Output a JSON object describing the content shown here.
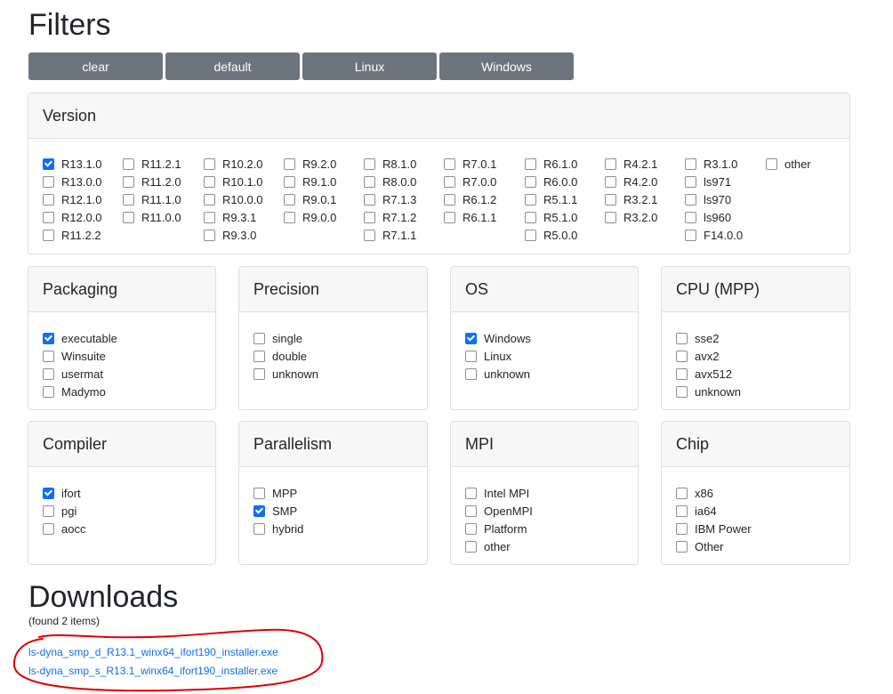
{
  "filters_title": "Filters",
  "buttons": [
    "clear",
    "default",
    "Linux",
    "Windows"
  ],
  "version": {
    "title": "Version",
    "columns": [
      [
        {
          "label": "R13.1.0",
          "checked": true
        },
        {
          "label": "R13.0.0",
          "checked": false
        },
        {
          "label": "R12.1.0",
          "checked": false
        },
        {
          "label": "R12.0.0",
          "checked": false
        },
        {
          "label": "R11.2.2",
          "checked": false
        }
      ],
      [
        {
          "label": "R11.2.1",
          "checked": false
        },
        {
          "label": "R11.2.0",
          "checked": false
        },
        {
          "label": "R11.1.0",
          "checked": false
        },
        {
          "label": "R11.0.0",
          "checked": false
        }
      ],
      [
        {
          "label": "R10.2.0",
          "checked": false
        },
        {
          "label": "R10.1.0",
          "checked": false
        },
        {
          "label": "R10.0.0",
          "checked": false
        },
        {
          "label": "R9.3.1",
          "checked": false
        },
        {
          "label": "R9.3.0",
          "checked": false
        }
      ],
      [
        {
          "label": "R9.2.0",
          "checked": false
        },
        {
          "label": "R9.1.0",
          "checked": false
        },
        {
          "label": "R9.0.1",
          "checked": false
        },
        {
          "label": "R9.0.0",
          "checked": false
        }
      ],
      [
        {
          "label": "R8.1.0",
          "checked": false
        },
        {
          "label": "R8.0.0",
          "checked": false
        },
        {
          "label": "R7.1.3",
          "checked": false
        },
        {
          "label": "R7.1.2",
          "checked": false
        },
        {
          "label": "R7.1.1",
          "checked": false
        }
      ],
      [
        {
          "label": "R7.0.1",
          "checked": false
        },
        {
          "label": "R7.0.0",
          "checked": false
        },
        {
          "label": "R6.1.2",
          "checked": false
        },
        {
          "label": "R6.1.1",
          "checked": false
        }
      ],
      [
        {
          "label": "R6.1.0",
          "checked": false
        },
        {
          "label": "R6.0.0",
          "checked": false
        },
        {
          "label": "R5.1.1",
          "checked": false
        },
        {
          "label": "R5.1.0",
          "checked": false
        },
        {
          "label": "R5.0.0",
          "checked": false
        }
      ],
      [
        {
          "label": "R4.2.1",
          "checked": false
        },
        {
          "label": "R4.2.0",
          "checked": false
        },
        {
          "label": "R3.2.1",
          "checked": false
        },
        {
          "label": "R3.2.0",
          "checked": false
        }
      ],
      [
        {
          "label": "R3.1.0",
          "checked": false
        },
        {
          "label": "ls971",
          "checked": false
        },
        {
          "label": "ls970",
          "checked": false
        },
        {
          "label": "ls960",
          "checked": false
        },
        {
          "label": "F14.0.0",
          "checked": false
        }
      ],
      [
        {
          "label": "other",
          "checked": false
        }
      ]
    ]
  },
  "cards": [
    {
      "title": "Packaging",
      "options": [
        {
          "label": "executable",
          "checked": true
        },
        {
          "label": "Winsuite",
          "checked": false
        },
        {
          "label": "usermat",
          "checked": false
        },
        {
          "label": "Madymo",
          "checked": false
        }
      ]
    },
    {
      "title": "Precision",
      "options": [
        {
          "label": "single",
          "checked": false
        },
        {
          "label": "double",
          "checked": false
        },
        {
          "label": "unknown",
          "checked": false
        }
      ]
    },
    {
      "title": "OS",
      "options": [
        {
          "label": "Windows",
          "checked": true
        },
        {
          "label": "Linux",
          "checked": false
        },
        {
          "label": "unknown",
          "checked": false
        }
      ]
    },
    {
      "title": "CPU (MPP)",
      "options": [
        {
          "label": "sse2",
          "checked": false
        },
        {
          "label": "avx2",
          "checked": false
        },
        {
          "label": "avx512",
          "checked": false
        },
        {
          "label": "unknown",
          "checked": false
        }
      ]
    },
    {
      "title": "Compiler",
      "options": [
        {
          "label": "ifort",
          "checked": true
        },
        {
          "label": "pgi",
          "checked": false
        },
        {
          "label": "aocc",
          "checked": false
        }
      ]
    },
    {
      "title": "Parallelism",
      "options": [
        {
          "label": "MPP",
          "checked": false
        },
        {
          "label": "SMP",
          "checked": true
        },
        {
          "label": "hybrid",
          "checked": false
        }
      ]
    },
    {
      "title": "MPI",
      "options": [
        {
          "label": "Intel MPI",
          "checked": false
        },
        {
          "label": "OpenMPI",
          "checked": false
        },
        {
          "label": "Platform",
          "checked": false
        },
        {
          "label": "other",
          "checked": false
        }
      ]
    },
    {
      "title": "Chip",
      "options": [
        {
          "label": "x86",
          "checked": false
        },
        {
          "label": "ia64",
          "checked": false
        },
        {
          "label": "IBM Power",
          "checked": false
        },
        {
          "label": "Other",
          "checked": false
        }
      ]
    }
  ],
  "downloads": {
    "title": "Downloads",
    "found": "(found 2 items)",
    "links": [
      "ls-dyna_smp_d_R13.1_winx64_ifort190_installer.exe",
      "ls-dyna_smp_s_R13.1_winx64_ifort190_installer.exe"
    ]
  },
  "colors": {
    "button_bg": "#6c757d",
    "accent": "#0d6efd",
    "annotation": "#e00000"
  }
}
